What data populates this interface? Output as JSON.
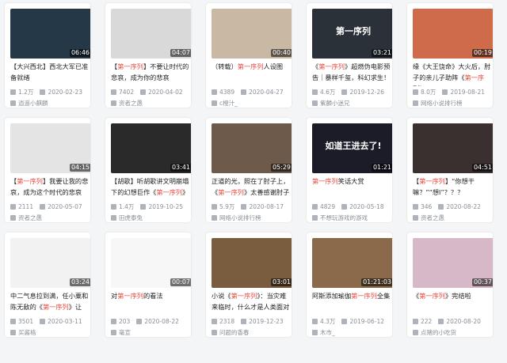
{
  "cards": [
    {
      "dur": "06:46",
      "pre": "【大兴西北】",
      "hl": "",
      "post": "西北大军已准备就绪",
      "plays": "1.2万",
      "date": "2020-02-23",
      "author": "逍遥小麒麟",
      "thumb": "#243848",
      "thumbtext": ""
    },
    {
      "dur": "04:07",
      "pre": "【",
      "hl": "第一序列",
      "post": "】不要让时代的悲哀，成为你的悲哀",
      "plays": "7402",
      "date": "2020-04-02",
      "author": "资者之愚",
      "thumb": "#d9d9d9",
      "thumbtext": ""
    },
    {
      "dur": "00:40",
      "pre": "（转载）",
      "hl": "第一序列",
      "post": "人设图",
      "plays": "4389",
      "date": "2020-04-27",
      "author": "c橙汁_",
      "thumb": "#c9b8a4",
      "thumbtext": ""
    },
    {
      "dur": "03:21",
      "pre": "《",
      "hl": "第一序列",
      "post": "》超燃伪电影预告｜暴样千玺，科幻求生！",
      "plays": "4.6万",
      "date": "2019-12-26",
      "author": "紫麟小迷兄",
      "thumb": "#2b3138",
      "thumbtext": "第一序列"
    },
    {
      "dur": "00:19",
      "pre": "缘《大王饶命》大火后，肘子的亲儿子助阵《",
      "hl": "第一序",
      "post": "列》",
      "plays": "8.0万",
      "date": "2019-08-21",
      "author": "网络小说排行榜",
      "thumb": "#cf6b4b",
      "thumbtext": ""
    },
    {
      "dur": "04:15",
      "pre": "【",
      "hl": "第一序列",
      "post": "】我要让我的悲哀，成为这个时代的悲哀",
      "plays": "2111",
      "date": "2020-05-07",
      "author": "资者之愚",
      "thumb": "#e4e4e4",
      "thumbtext": ""
    },
    {
      "dur": "03:41",
      "pre": "【胡歌】听胡歌讲文明崩塌下的幻想巨作《",
      "hl": "第一序列",
      "post": "》",
      "plays": "1.4万",
      "date": "2019-10-25",
      "author": "田虎泰兔",
      "thumb": "#2a2a2a",
      "thumbtext": ""
    },
    {
      "dur": "05:29",
      "pre": "正道的光，照在了肘子上，《",
      "hl": "第一序列",
      "post": "》太善感谢肘子",
      "plays": "5.9万",
      "date": "2020-08-17",
      "author": "网络小说排行榜",
      "thumb": "#6d5a4a",
      "thumbtext": ""
    },
    {
      "dur": "01:21",
      "pre": "",
      "hl": "第一序列",
      "post": "笑话大赏",
      "plays": "4829",
      "date": "2020-05-18",
      "author": "不想玩游戏的游戏",
      "thumb": "#1c1c28",
      "thumbtext": "如道王进去了!"
    },
    {
      "dur": "04:51",
      "pre": "【",
      "hl": "第一序列",
      "post": "】“你想干嘛？”“想I”？？？",
      "plays": "346",
      "date": "2020-08-22",
      "author": "资者之愚",
      "thumb": "#3a3030",
      "thumbtext": ""
    },
    {
      "dur": "03:24",
      "pre": "中二气息拉到满，任小粟和陈无敌的《",
      "hl": "第一序列",
      "post": "》让",
      "plays": "3501",
      "date": "2020-03-11",
      "author": "买酱格",
      "thumb": "#f2f2f2",
      "thumbtext": ""
    },
    {
      "dur": "00:07",
      "pre": "对",
      "hl": "第一序列",
      "post": "的看法",
      "plays": "203",
      "date": "2020-08-22",
      "author": "毫宣",
      "thumb": "#f7f7f7",
      "thumbtext": ""
    },
    {
      "dur": "03:01",
      "pre": "小说《",
      "hl": "第一序列",
      "post": "》：当灾难来临时，什么才是人类面对",
      "plays": "2318",
      "date": "2019-12-23",
      "author": "问题的香春",
      "thumb": "#7a5d3e",
      "thumbtext": ""
    },
    {
      "dur": "01:21:03",
      "pre": "阿斯添加瑜伽",
      "hl": "第一序列",
      "post": "全集",
      "plays": "4.3万",
      "date": "2019-06-12",
      "author": "木市_",
      "thumb": "#8a6a4a",
      "thumbtext": ""
    },
    {
      "dur": "00:37",
      "pre": "《",
      "hl": "第一序列",
      "post": "》完结啦",
      "plays": "222",
      "date": "2020-08-20",
      "author": "点赌的小吃货",
      "thumb": "#d7b8c8",
      "thumbtext": ""
    }
  ]
}
